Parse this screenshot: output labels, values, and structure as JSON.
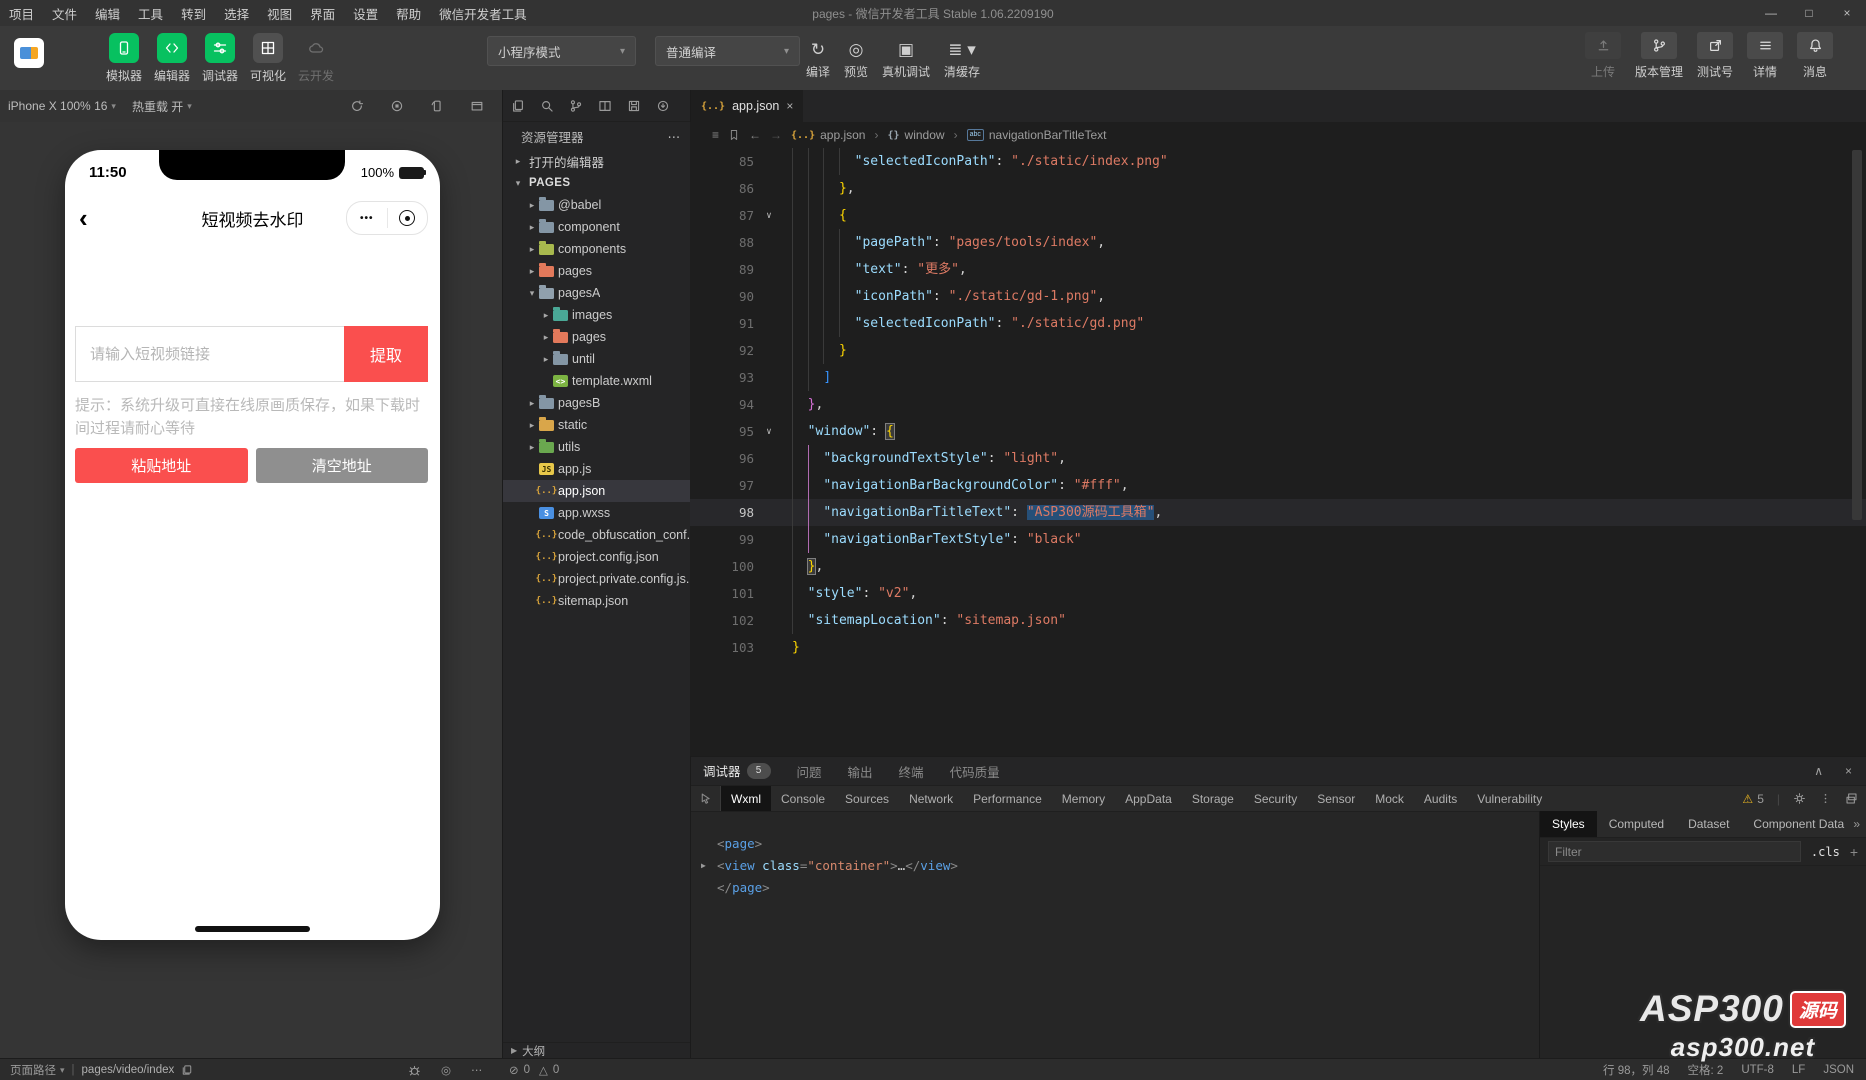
{
  "window": {
    "title": "pages - 微信开发者工具 Stable 1.06.2209190",
    "controls": [
      {
        "name": "minimize",
        "glyph": "—"
      },
      {
        "name": "maximize",
        "glyph": "□"
      },
      {
        "name": "close",
        "glyph": "×"
      }
    ]
  },
  "menu": {
    "items": [
      "项目",
      "文件",
      "编辑",
      "工具",
      "转到",
      "选择",
      "视图",
      "界面",
      "设置",
      "帮助",
      "微信开发者工具"
    ]
  },
  "toolbar": {
    "left_buttons": [
      {
        "label": "模拟器",
        "icon": "phone-icon",
        "style": "green"
      },
      {
        "label": "编辑器",
        "icon": "code-icon",
        "style": "green"
      },
      {
        "label": "调试器",
        "icon": "sliders-icon",
        "style": "green"
      },
      {
        "label": "可视化",
        "icon": "grid-icon",
        "style": "dark"
      },
      {
        "label": "云开发",
        "icon": "cloud-icon",
        "style": "disabled"
      }
    ],
    "mode_select": "小程序模式",
    "compile_select": "普通编译",
    "action_buttons": [
      {
        "label": "编译",
        "glyph": "↻"
      },
      {
        "label": "预览",
        "glyph": "◎"
      },
      {
        "label": "真机调试",
        "glyph": "▣"
      },
      {
        "label": "清缓存",
        "glyph": "≣",
        "caret": "▾"
      }
    ],
    "right_buttons": [
      {
        "label": "上传",
        "icon": "upload-icon",
        "disabled": true
      },
      {
        "label": "版本管理",
        "icon": "branch-icon"
      },
      {
        "label": "测试号",
        "icon": "external-icon"
      },
      {
        "label": "详情",
        "icon": "list-icon"
      },
      {
        "label": "消息",
        "icon": "bell-icon"
      }
    ]
  },
  "simulator": {
    "device_label": "iPhone X 100% 16",
    "hot_reload_label": "热重载 开",
    "strip_icons": [
      "refresh-icon",
      "record-icon",
      "rotate-icon",
      "window-icon"
    ],
    "phone": {
      "time": "11:50",
      "battery": "100%",
      "back_glyph": "‹",
      "nav_title": "短视频去水印",
      "capsule_dots": "•••",
      "input_placeholder": "请输入短视频链接",
      "extract_button": "提取",
      "tip": "提示：系统升级可直接在线原画质保存，如果下载时间过程请耐心等待",
      "paste_button": "粘贴地址",
      "clear_button": "清空地址"
    }
  },
  "explorer": {
    "strip_icons": [
      "files-icon",
      "search-icon",
      "branch-icon",
      "split-icon",
      "save-icon",
      "sync-icon"
    ],
    "title": "资源管理器",
    "more_glyph": "⋯",
    "tree": [
      {
        "label": "打开的编辑器",
        "arrow": "collapsed",
        "indent": 0,
        "type": "section"
      },
      {
        "label": "PAGES",
        "arrow": "expanded",
        "indent": 0,
        "type": "section-bold"
      },
      {
        "label": "@babel",
        "icon": "folder",
        "color": "#8496a5",
        "arrow": "collapsed",
        "indent": 1
      },
      {
        "label": "component",
        "icon": "folder",
        "color": "#8496a5",
        "arrow": "collapsed",
        "indent": 1
      },
      {
        "label": "components",
        "icon": "folder",
        "color": "#a8b94e",
        "arrow": "collapsed",
        "indent": 1
      },
      {
        "label": "pages",
        "icon": "folder",
        "color": "#e2795b",
        "arrow": "collapsed",
        "indent": 1
      },
      {
        "label": "pagesA",
        "icon": "folder",
        "color": "#90a0ad",
        "arrow": "expanded",
        "indent": 1
      },
      {
        "label": "images",
        "icon": "folder",
        "color": "#4aa896",
        "arrow": "collapsed",
        "indent": 2
      },
      {
        "label": "pages",
        "icon": "folder",
        "color": "#e2795b",
        "arrow": "collapsed",
        "indent": 2
      },
      {
        "label": "until",
        "icon": "folder",
        "color": "#8496a5",
        "arrow": "collapsed",
        "indent": 2
      },
      {
        "label": "template.wxml",
        "icon": "file",
        "glyph": "<>",
        "color": "#7cb342",
        "fg": "#ffffff",
        "indent": 2
      },
      {
        "label": "pagesB",
        "icon": "folder",
        "color": "#8496a5",
        "arrow": "collapsed",
        "indent": 1
      },
      {
        "label": "static",
        "icon": "folder",
        "color": "#d9a64a",
        "arrow": "collapsed",
        "indent": 1
      },
      {
        "label": "utils",
        "icon": "folder",
        "color": "#6aa84f",
        "arrow": "collapsed",
        "indent": 1
      },
      {
        "label": "app.js",
        "icon": "file",
        "glyph": "JS",
        "color": "#e8c84a",
        "fg": "#3a3000",
        "indent": 1
      },
      {
        "label": "app.json",
        "icon": "file",
        "glyph": "{..}",
        "color": "transparent",
        "fg": "#d9a43b",
        "indent": 1,
        "selected": true
      },
      {
        "label": "app.wxss",
        "icon": "file",
        "glyph": "S",
        "color": "#4a90e2",
        "fg": "#ffffff",
        "indent": 1
      },
      {
        "label": "code_obfuscation_conf...",
        "icon": "file",
        "glyph": "{..}",
        "color": "transparent",
        "fg": "#d9a43b",
        "indent": 1
      },
      {
        "label": "project.config.json",
        "icon": "file",
        "glyph": "{..}",
        "color": "transparent",
        "fg": "#d9a43b",
        "indent": 1
      },
      {
        "label": "project.private.config.js...",
        "icon": "file",
        "glyph": "{..}",
        "color": "transparent",
        "fg": "#d9a43b",
        "indent": 1
      },
      {
        "label": "sitemap.json",
        "icon": "file",
        "glyph": "{..}",
        "color": "transparent",
        "fg": "#d9a43b",
        "indent": 1
      }
    ],
    "outline_label": "大纲"
  },
  "editor": {
    "tab_label": "app.json",
    "tab_icon": "{..}",
    "close_glyph": "×",
    "breadcrumb": [
      {
        "icon": "{..}",
        "label": "app.json"
      },
      {
        "icon": "{}",
        "label": "window"
      },
      {
        "icon": "abc",
        "label": "navigationBarTitleText"
      }
    ],
    "lines": [
      {
        "n": 85,
        "i": 8,
        "t": [
          [
            "k",
            "\"selectedIconPath\""
          ],
          [
            "p",
            ": "
          ],
          [
            "s",
            "\"./static/index.png\""
          ]
        ]
      },
      {
        "n": 86,
        "i": 6,
        "t": [
          [
            "b1",
            "}"
          ],
          [
            "p",
            ","
          ]
        ]
      },
      {
        "n": 87,
        "i": 6,
        "fold": true,
        "t": [
          [
            "b1",
            "{"
          ]
        ]
      },
      {
        "n": 88,
        "i": 8,
        "t": [
          [
            "k",
            "\"pagePath\""
          ],
          [
            "p",
            ": "
          ],
          [
            "s",
            "\"pages/tools/index\""
          ],
          [
            "p",
            ","
          ]
        ]
      },
      {
        "n": 89,
        "i": 8,
        "t": [
          [
            "k",
            "\"text\""
          ],
          [
            "p",
            ": "
          ],
          [
            "s",
            "\"更多\""
          ],
          [
            "p",
            ","
          ]
        ]
      },
      {
        "n": 90,
        "i": 8,
        "t": [
          [
            "k",
            "\"iconPath\""
          ],
          [
            "p",
            ": "
          ],
          [
            "s",
            "\"./static/gd-1.png\""
          ],
          [
            "p",
            ","
          ]
        ]
      },
      {
        "n": 91,
        "i": 8,
        "t": [
          [
            "k",
            "\"selectedIconPath\""
          ],
          [
            "p",
            ": "
          ],
          [
            "s",
            "\"./static/gd.png\""
          ]
        ]
      },
      {
        "n": 92,
        "i": 6,
        "t": [
          [
            "b1",
            "}"
          ]
        ]
      },
      {
        "n": 93,
        "i": 4,
        "t": [
          [
            "b3",
            "]"
          ]
        ]
      },
      {
        "n": 94,
        "i": 2,
        "t": [
          [
            "b2",
            "}"
          ],
          [
            "p",
            ","
          ]
        ]
      },
      {
        "n": 95,
        "i": 2,
        "fold": true,
        "t": [
          [
            "k",
            "\"window\""
          ],
          [
            "p",
            ": "
          ],
          [
            "bm",
            "{"
          ]
        ]
      },
      {
        "n": 96,
        "i": 4,
        "ag": true,
        "t": [
          [
            "k",
            "\"backgroundTextStyle\""
          ],
          [
            "p",
            ": "
          ],
          [
            "s",
            "\"light\""
          ],
          [
            "p",
            ","
          ]
        ]
      },
      {
        "n": 97,
        "i": 4,
        "ag": true,
        "t": [
          [
            "k",
            "\"navigationBarBackgroundColor\""
          ],
          [
            "p",
            ": "
          ],
          [
            "s",
            "\"#fff\""
          ],
          [
            "p",
            ","
          ]
        ]
      },
      {
        "n": 98,
        "i": 4,
        "ag": true,
        "cur": true,
        "t": [
          [
            "k",
            "\"navigationBarTitleText\""
          ],
          [
            "p",
            ": "
          ],
          [
            "sel",
            "\"ASP300源码工具箱\""
          ],
          [
            "p",
            ","
          ]
        ]
      },
      {
        "n": 99,
        "i": 4,
        "ag": true,
        "t": [
          [
            "k",
            "\"navigationBarTextStyle\""
          ],
          [
            "p",
            ": "
          ],
          [
            "s",
            "\"black\""
          ]
        ]
      },
      {
        "n": 100,
        "i": 2,
        "t": [
          [
            "bm",
            "}"
          ],
          [
            "p",
            ","
          ]
        ]
      },
      {
        "n": 101,
        "i": 2,
        "t": [
          [
            "k",
            "\"style\""
          ],
          [
            "p",
            ": "
          ],
          [
            "s",
            "\"v2\""
          ],
          [
            "p",
            ","
          ]
        ]
      },
      {
        "n": 102,
        "i": 2,
        "t": [
          [
            "k",
            "\"sitemapLocation\""
          ],
          [
            "p",
            ": "
          ],
          [
            "s",
            "\"sitemap.json\""
          ]
        ]
      },
      {
        "n": 103,
        "i": 0,
        "t": [
          [
            "b1",
            "}"
          ]
        ]
      }
    ]
  },
  "debugger": {
    "tabs": [
      {
        "label": "调试器",
        "badge": "5",
        "active": true
      },
      {
        "label": "问题"
      },
      {
        "label": "输出"
      },
      {
        "label": "终端"
      },
      {
        "label": "代码质量"
      }
    ],
    "collapse_glyph": "∧",
    "close_glyph": "×",
    "devtools_tabs": [
      "Wxml",
      "Console",
      "Sources",
      "Network",
      "Performance",
      "Memory",
      "AppData",
      "Storage",
      "Security",
      "Sensor",
      "Mock",
      "Audits",
      "Vulnerability"
    ],
    "active_devtools_tab": "Wxml",
    "warning_glyph": "⚠",
    "warning_count": "5",
    "wxml_lines": [
      {
        "t": [
          [
            "wp",
            "<"
          ],
          [
            "wt",
            "page"
          ],
          [
            "wp",
            ">"
          ]
        ]
      },
      {
        "arrow": true,
        "t": [
          [
            "wp",
            "<"
          ],
          [
            "wt",
            "view"
          ],
          [
            "ww",
            " "
          ],
          [
            "wa",
            "class"
          ],
          [
            "wp",
            "="
          ],
          [
            "ws",
            "\"container\""
          ],
          [
            "wp",
            ">"
          ],
          [
            "ww",
            "…"
          ],
          [
            "wp",
            "</"
          ],
          [
            "wt",
            "view"
          ],
          [
            "wp",
            ">"
          ]
        ]
      },
      {
        "t": [
          [
            "wp",
            "</"
          ],
          [
            "wt",
            "page"
          ],
          [
            "wp",
            ">"
          ]
        ]
      }
    ],
    "styles_tabs": [
      "Styles",
      "Computed",
      "Dataset",
      "Component Data"
    ],
    "active_styles_tab": "Styles",
    "styles_more_glyph": "»",
    "filter_placeholder": "Filter",
    "cls_label": ".cls",
    "add_glyph": "+"
  },
  "statusbar": {
    "page_path_label": "页面路径",
    "page_path": "pages/video/index",
    "error_glyph": "⊘",
    "error_count": "0",
    "warn_glyph": "△",
    "warn_count": "0",
    "more_glyph": "⋯",
    "eye_glyph": "◎",
    "line_col": "行 98，列 48",
    "spaces": "空格: 2",
    "encoding": "UTF-8",
    "eol": "LF",
    "language": "JSON"
  },
  "watermark": {
    "brand": "ASP300",
    "badge": "源码",
    "domain": "asp300.net"
  }
}
